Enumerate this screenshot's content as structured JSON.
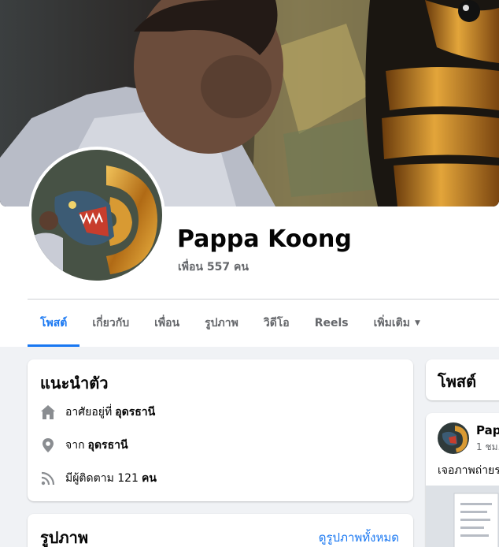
{
  "profile": {
    "name": "Pappa Koong",
    "friends_text": "เพื่อน 557 คน"
  },
  "tabs": [
    {
      "label": "โพสต์",
      "active": true
    },
    {
      "label": "เกี่ยวกับ",
      "active": false
    },
    {
      "label": "เพื่อน",
      "active": false
    },
    {
      "label": "รูปภาพ",
      "active": false
    },
    {
      "label": "วิดีโอ",
      "active": false
    },
    {
      "label": "Reels",
      "active": false
    },
    {
      "label": "เพิ่มเติม",
      "active": false,
      "icon": "caret-down-icon"
    }
  ],
  "intro": {
    "title": "แนะนำตัว",
    "lives_prefix": "อาศัยอยู่ที่",
    "lives_value": "อุดรธานี",
    "from_prefix": "จาก",
    "from_value": "อุดรธานี",
    "followers_prefix": "มีผู้ติดตาม 121",
    "followers_unit": "คน"
  },
  "photos": {
    "title": "รูปภาพ",
    "see_all": "ดูรูปภาพทั้งหมด"
  },
  "posts": {
    "title": "โพสต์",
    "author": "Papp",
    "time": "1 ชม.",
    "text": "เจอภาพถ่ายร"
  },
  "colors": {
    "accent": "#1877f2",
    "secondary_text": "#65676b",
    "page_bg": "#f0f2f5",
    "icon_gray": "#8a8d91"
  }
}
